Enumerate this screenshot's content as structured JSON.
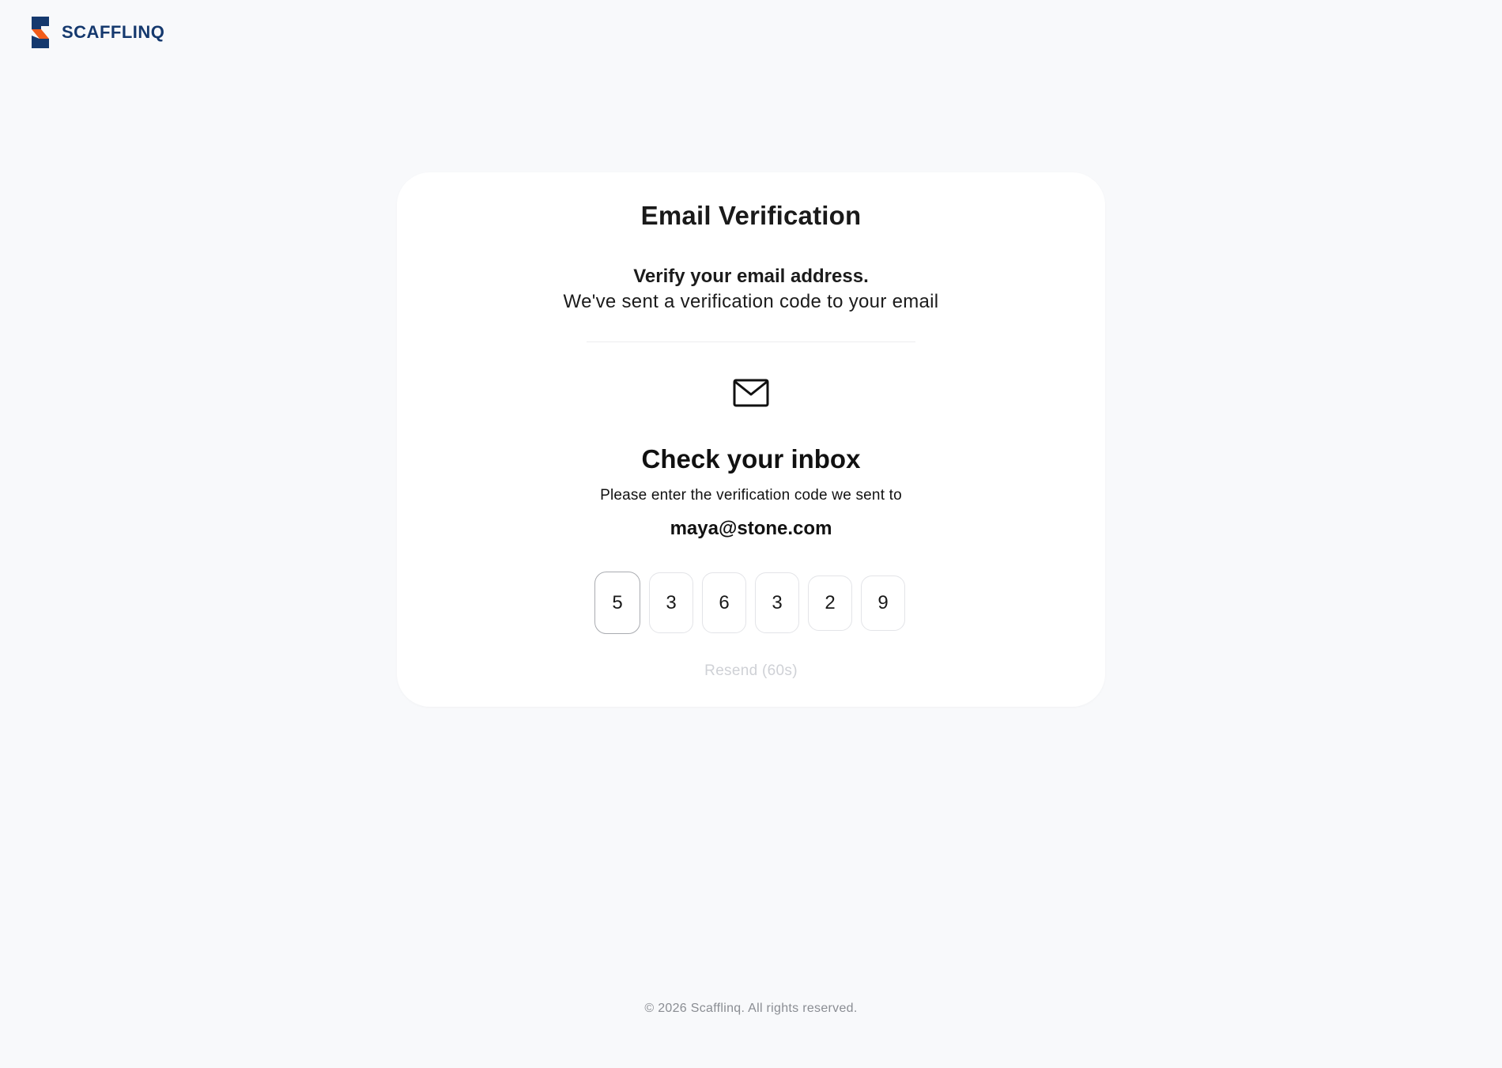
{
  "brand": {
    "name": "SCAFFLINQ",
    "colors": {
      "primary": "#15396e",
      "accent": "#f25c1a"
    }
  },
  "card": {
    "title": "Email Verification",
    "subtitle_strong": "Verify your email address.",
    "subtitle_normal": "We've sent a verification code to your email",
    "icon": "mail-icon",
    "inbox_title": "Check your inbox",
    "inbox_text": "Please enter the verification code we sent to",
    "email": "maya@stone.com",
    "otp_digits": [
      "5",
      "3",
      "6",
      "3",
      "2",
      "9"
    ],
    "resend_label": "Resend (60s)"
  },
  "footer": {
    "copyright": "© 2026 Scafflinq. All rights reserved."
  }
}
